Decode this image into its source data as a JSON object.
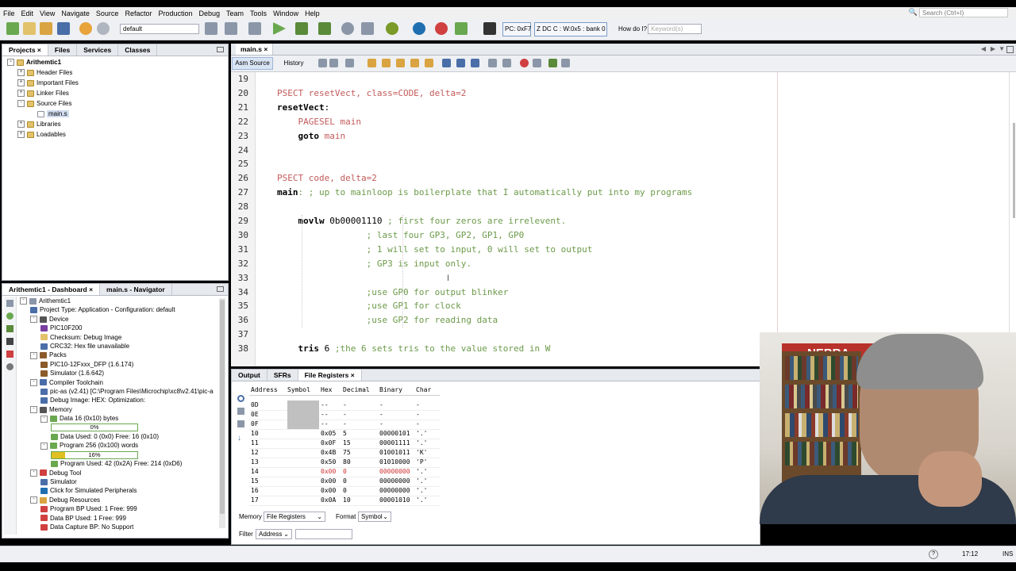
{
  "menu": [
    "File",
    "Edit",
    "View",
    "Navigate",
    "Source",
    "Refactor",
    "Production",
    "Debug",
    "Team",
    "Tools",
    "Window",
    "Help"
  ],
  "search": {
    "placeholder": "Search (Ctrl+I)"
  },
  "toolbar": {
    "config_select": "default",
    "pc_box": "PC: 0xF7",
    "status_box": "Z DC C  : W:0x5 : bank 0",
    "howdoi_label": "How do I?",
    "keyword_placeholder": "Keyword(s)"
  },
  "projects_panel": {
    "tabs": [
      "Projects",
      "Files",
      "Services",
      "Classes"
    ],
    "tree": [
      {
        "label": "Arithemtic1",
        "indent": 0,
        "bold": true,
        "toggle": "-",
        "icon": "folder"
      },
      {
        "label": "Header Files",
        "indent": 1,
        "toggle": "+",
        "icon": "folder"
      },
      {
        "label": "Important Files",
        "indent": 1,
        "toggle": "+",
        "icon": "folder"
      },
      {
        "label": "Linker Files",
        "indent": 1,
        "toggle": "+",
        "icon": "folder"
      },
      {
        "label": "Source Files",
        "indent": 1,
        "toggle": "-",
        "icon": "folder"
      },
      {
        "label": "main.s",
        "indent": 2,
        "toggle": "",
        "icon": "file",
        "selected": true
      },
      {
        "label": "Libraries",
        "indent": 1,
        "toggle": "+",
        "icon": "folder"
      },
      {
        "label": "Loadables",
        "indent": 1,
        "toggle": "+",
        "icon": "folder"
      }
    ]
  },
  "dashboard_panel": {
    "tabs": [
      "Arithemtic1 - Dashboard",
      "main.s - Navigator"
    ],
    "items": [
      {
        "label": "Arithemtic1",
        "indent": 0,
        "toggle": "-"
      },
      {
        "label": "Project Type: Application - Configuration: default",
        "indent": 1,
        "toggle": ""
      },
      {
        "label": "Device",
        "indent": 1,
        "toggle": "-"
      },
      {
        "label": "PIC10F200",
        "indent": 2,
        "toggle": ""
      },
      {
        "label": "Checksum: Debug Image",
        "indent": 2,
        "toggle": ""
      },
      {
        "label": "CRC32: Hex file unavailable",
        "indent": 2,
        "toggle": ""
      },
      {
        "label": "Packs",
        "indent": 1,
        "toggle": "-"
      },
      {
        "label": "PIC10-12Fxxx_DFP (1.6.174)",
        "indent": 2,
        "toggle": ""
      },
      {
        "label": "Simulator (1.6.642)",
        "indent": 2,
        "toggle": ""
      },
      {
        "label": "Compiler Toolchain",
        "indent": 1,
        "toggle": "-"
      },
      {
        "label": "pic-as (v2.41) [C:\\Program Files\\Microchip\\xc8\\v2.41\\pic-as",
        "indent": 2,
        "toggle": ""
      },
      {
        "label": "Debug Image: HEX: Optimization:",
        "indent": 2,
        "toggle": ""
      },
      {
        "label": "Memory",
        "indent": 1,
        "toggle": "-"
      },
      {
        "label": "Data 16 (0x10) bytes",
        "indent": 2,
        "toggle": "-"
      },
      {
        "label": "",
        "indent": 3,
        "bar": "0%",
        "fill": 0.0
      },
      {
        "label": "Data Used: 0 (0x0) Free: 16 (0x10)",
        "indent": 3,
        "toggle": ""
      },
      {
        "label": "Program 256 (0x100) words",
        "indent": 2,
        "toggle": "-"
      },
      {
        "label": "",
        "indent": 3,
        "bar": "16%",
        "fill": 0.16
      },
      {
        "label": "Program Used: 42 (0x2A) Free: 214 (0xD6)",
        "indent": 3,
        "toggle": ""
      },
      {
        "label": "Debug Tool",
        "indent": 1,
        "toggle": "-"
      },
      {
        "label": "Simulator",
        "indent": 2,
        "toggle": ""
      },
      {
        "label": "Click for Simulated Peripherals",
        "indent": 2,
        "toggle": ""
      },
      {
        "label": "Debug Resources",
        "indent": 1,
        "toggle": "-"
      },
      {
        "label": "Program BP Used: 1 Free: 999",
        "indent": 2,
        "toggle": ""
      },
      {
        "label": "Data BP Used: 1 Free: 999",
        "indent": 2,
        "toggle": ""
      },
      {
        "label": "Data Capture BP: No Support",
        "indent": 2,
        "toggle": ""
      }
    ]
  },
  "editor": {
    "tab": "main.s",
    "subtabs": [
      "Asm Source",
      "History"
    ],
    "lines": [
      {
        "n": "19",
        "parts": []
      },
      {
        "n": "20",
        "parts": [
          {
            "t": "PSECT resetVect, class=CODE, delta=2",
            "c": "kw"
          }
        ]
      },
      {
        "n": "21",
        "parts": [
          {
            "t": "resetVect",
            "c": "bold"
          },
          {
            "t": ":",
            "c": ""
          }
        ]
      },
      {
        "n": "22",
        "parts": [
          {
            "t": "    PAGESEL main",
            "c": "kw"
          }
        ]
      },
      {
        "n": "23",
        "parts": [
          {
            "t": "    goto",
            "c": "bold"
          },
          {
            "t": " main",
            "c": "kw"
          }
        ]
      },
      {
        "n": "24",
        "parts": []
      },
      {
        "n": "25",
        "parts": []
      },
      {
        "n": "26",
        "parts": [
          {
            "t": "PSECT code, delta=2",
            "c": "kw"
          }
        ]
      },
      {
        "n": "27",
        "parts": [
          {
            "t": "main",
            "c": "bold"
          },
          {
            "t": ": ; up to mainloop is boilerplate that I automatically put into my programs",
            "c": "cm"
          }
        ]
      },
      {
        "n": "28",
        "parts": []
      },
      {
        "n": "29",
        "parts": [
          {
            "t": "    movlw",
            "c": "bold"
          },
          {
            "t": " 0b00001110",
            "c": ""
          },
          {
            "t": " ; first four zeros are irrelevent.",
            "c": "cm"
          }
        ]
      },
      {
        "n": "30",
        "parts": [
          {
            "t": "                 ; last four GP3, GP2, GP1, GP0",
            "c": "cm"
          }
        ]
      },
      {
        "n": "31",
        "parts": [
          {
            "t": "                 ; 1 will set to input, 0 will set to output",
            "c": "cm"
          }
        ]
      },
      {
        "n": "32",
        "parts": [
          {
            "t": "                 ; GP3 is input only.",
            "c": "cm"
          }
        ]
      },
      {
        "n": "33",
        "parts": []
      },
      {
        "n": "34",
        "parts": [
          {
            "t": "                 ;use GP0 for output blinker",
            "c": "cm"
          }
        ]
      },
      {
        "n": "35",
        "parts": [
          {
            "t": "                 ;use GP1 for clock",
            "c": "cm"
          }
        ]
      },
      {
        "n": "36",
        "parts": [
          {
            "t": "                 ;use GP2 for reading data",
            "c": "cm"
          }
        ]
      },
      {
        "n": "37",
        "parts": []
      },
      {
        "n": "38",
        "parts": [
          {
            "t": "    tris",
            "c": "bold"
          },
          {
            "t": " 6",
            "c": ""
          },
          {
            "t": " ;the 6 sets tris to the value stored in W",
            "c": "cm"
          }
        ]
      }
    ]
  },
  "bottom_panel": {
    "tabs": [
      "Output",
      "SFRs",
      "File Registers"
    ],
    "columns": [
      "Address",
      "Symbol",
      "Hex",
      "Decimal",
      "Binary",
      "Char"
    ],
    "rows": [
      [
        "0D",
        "",
        "--",
        "-",
        "-",
        "-"
      ],
      [
        "0E",
        "",
        "--",
        "-",
        "-",
        "-"
      ],
      [
        "0F",
        "",
        "--",
        "-",
        "-",
        "-"
      ],
      [
        "10",
        "",
        "0x05",
        "5",
        "00000101",
        "'.'"
      ],
      [
        "11",
        "",
        "0x0F",
        "15",
        "00001111",
        "'.'"
      ],
      [
        "12",
        "",
        "0x4B",
        "75",
        "01001011",
        "'K'"
      ],
      [
        "13",
        "",
        "0x50",
        "80",
        "01010000",
        "'P'"
      ],
      [
        "14",
        "",
        "0x00",
        "0",
        "00000000",
        "'.'"
      ],
      [
        "15",
        "",
        "0x00",
        "0",
        "00000000",
        "'.'"
      ],
      [
        "16",
        "",
        "0x00",
        "0",
        "00000000",
        "'.'"
      ],
      [
        "17",
        "",
        "0x0A",
        "10",
        "00001010",
        "'.'"
      ]
    ],
    "changed_row": "14",
    "memory_label": "Memory",
    "memory_value": "File Registers",
    "format_label": "Format",
    "format_value": "Symbol",
    "filter_label": "Filter",
    "filter_value": "Address"
  },
  "video": {
    "sign_text": "NEBRA"
  },
  "statusbar": {
    "time": "17:12",
    "mode": "INS"
  },
  "colors": {
    "comment": "#6c9a4a",
    "keyword": "#c35a5a",
    "changed": "#d03030",
    "accent": "#7a9cc8"
  }
}
